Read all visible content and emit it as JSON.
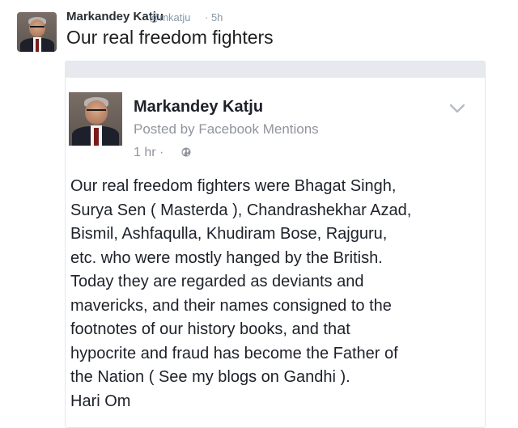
{
  "tweet": {
    "author_name": "Markandey Katju",
    "author_handle": "@mkatju",
    "time": "· 5h",
    "text": "Our real freedom fighters"
  },
  "embed": {
    "author_name": "Markandey Katju",
    "posted_by": "Posted by Facebook Mentions",
    "time": "1 hr ·",
    "privacy_icon": "globe-icon",
    "menu_icon": "chevron-down-icon",
    "body_lines": [
      "Our real freedom fighters were Bhagat Singh,",
      "Surya Sen ( Masterda ), Chandrashekhar Azad,",
      "Bismil, Ashfaqulla, Khudiram Bose, Rajguru,",
      "etc. who were mostly hanged by the British.",
      "Today they are regarded as deviants and",
      "mavericks, and their names consigned to the",
      "footnotes of our history books, and that",
      "hypocrite and fraud has become the Father of",
      "the Nation ( See my blogs on Gandhi ).",
      "Hari Om"
    ]
  }
}
